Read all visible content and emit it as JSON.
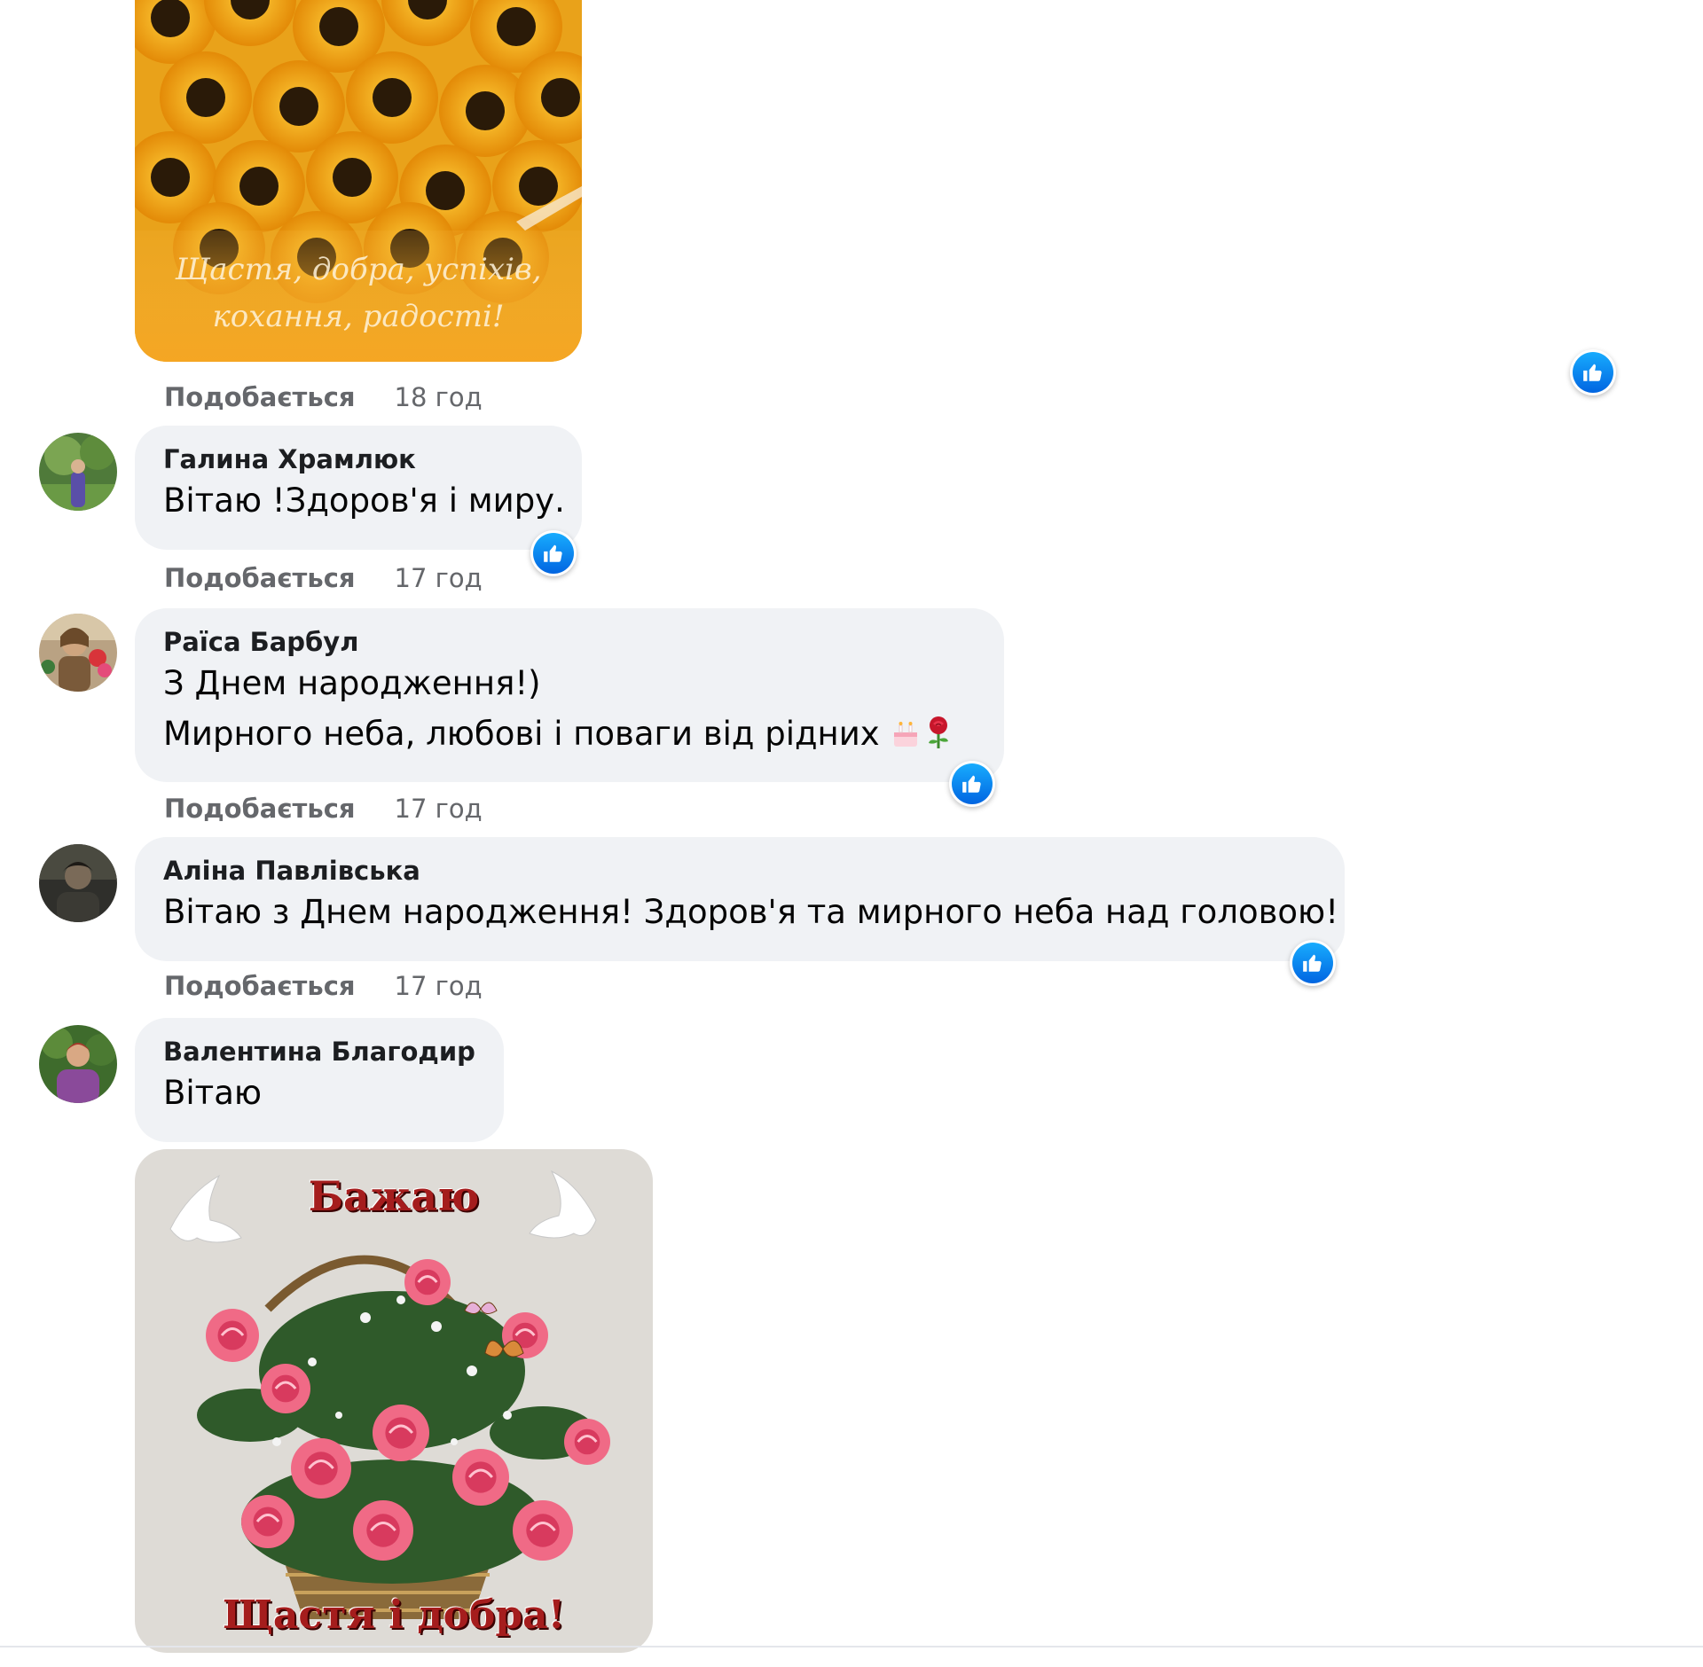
{
  "comments": [
    {
      "id": "top",
      "like_label": "Подобається",
      "time": "18 год"
    },
    {
      "id": "halyna",
      "author": "Галина Храмлюк",
      "lines": [
        "Вітаю !Здоров'я і миру."
      ],
      "like_label": "Подобається",
      "time": "17 год"
    },
    {
      "id": "raisa",
      "author": "Раїса Барбул",
      "lines": [
        "З Днем народження!)",
        "Мирного неба, любові і поваги від рідних"
      ],
      "like_label": "Подобається",
      "time": "17 год"
    },
    {
      "id": "alina",
      "author": "Аліна Павлівська",
      "lines": [
        "Вітаю з Днем народження! Здоров'я та мирного неба над головою!"
      ],
      "like_label": "Подобається",
      "time": "17 год"
    },
    {
      "id": "valentyna",
      "author": "Валентина Благодир",
      "lines": [
        "Вітаю"
      ]
    }
  ],
  "images": {
    "sunflowers_caption_line1": "Щастя, добра, успіхів,",
    "sunflowers_caption_line2": "кохання, радості!",
    "roses_title_top": "Бажаю",
    "roses_title_bottom": "Щастя і добра!"
  },
  "icons": {
    "like": "thumbs-up-icon",
    "cake": "birthday-cake-icon",
    "rose": "rose-icon"
  },
  "colors": {
    "bubble": "#f0f2f5",
    "like_blue": "#0866ff",
    "meta_text": "#65676b"
  }
}
